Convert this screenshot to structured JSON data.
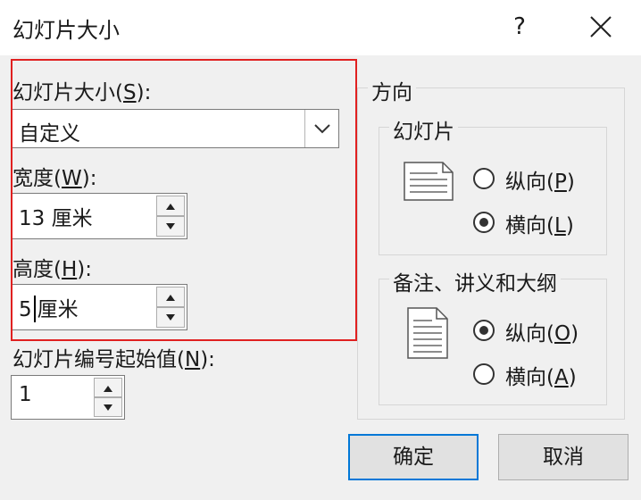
{
  "dialog": {
    "title": "幻灯片大小",
    "help_label": "?"
  },
  "slide_size": {
    "label_prefix": "幻灯片大小(",
    "label_key": "S",
    "label_suffix": "):",
    "selected": "自定义"
  },
  "width": {
    "label_prefix": "宽度(",
    "label_key": "W",
    "label_suffix": "):",
    "value": "13 厘米"
  },
  "height": {
    "label_prefix": "高度(",
    "label_key": "H",
    "label_suffix": "):",
    "value_number": "5",
    "value_unit": "厘米"
  },
  "start_number": {
    "label_prefix": "幻灯片编号起始值(",
    "label_key": "N",
    "label_suffix": "):",
    "value": "1"
  },
  "orientation": {
    "title": "方向",
    "slides": {
      "title": "幻灯片",
      "portrait_prefix": "纵向(",
      "portrait_key": "P",
      "portrait_suffix": ")",
      "landscape_prefix": "横向(",
      "landscape_key": "L",
      "landscape_suffix": ")",
      "selected": "landscape"
    },
    "notes": {
      "title": "备注、讲义和大纲",
      "portrait_prefix": "纵向(",
      "portrait_key": "O",
      "portrait_suffix": ")",
      "landscape_prefix": "横向(",
      "landscape_key": "A",
      "landscape_suffix": ")",
      "selected": "portrait"
    }
  },
  "buttons": {
    "ok": "确定",
    "cancel": "取消"
  },
  "colors": {
    "highlight_border": "#e02020",
    "default_button_border": "#0078d7"
  },
  "icons": [
    "landscape-page-icon",
    "portrait-page-icon",
    "close-icon",
    "chevron-down-icon",
    "spin-up-arrow-icon",
    "spin-down-arrow-icon"
  ]
}
